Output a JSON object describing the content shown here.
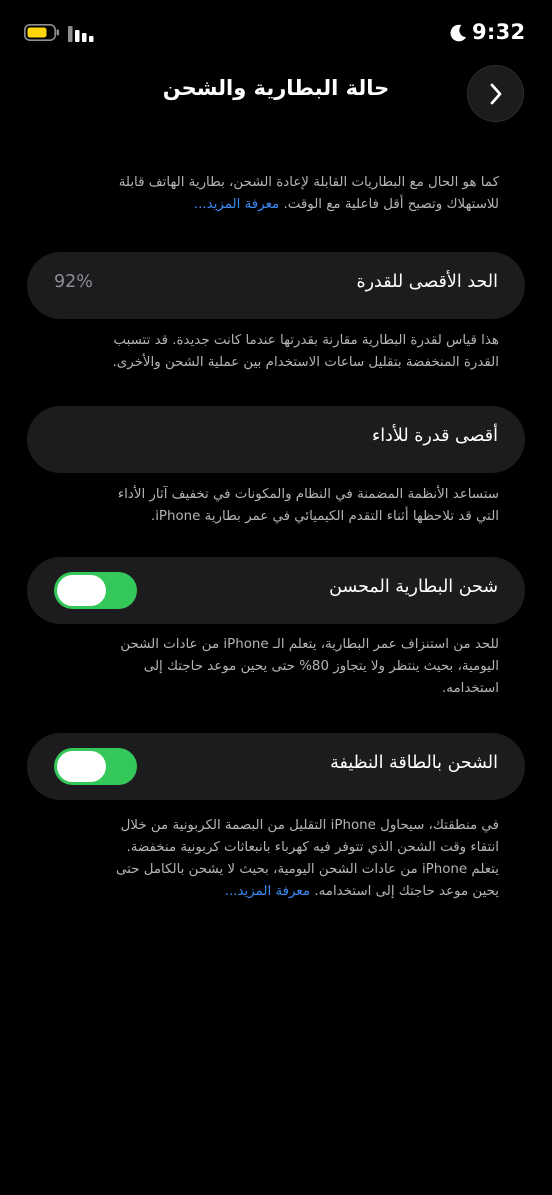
{
  "status_bar": {
    "time": "9:32",
    "battery_icon": "battery-low-power-icon",
    "signal_icon": "cellular-signal-icon",
    "focus_icon": "moon-icon",
    "battery_color": "#ffd60a"
  },
  "nav": {
    "title": "حالة البطارية والشحن",
    "back_icon": "chevron-icon"
  },
  "intro": {
    "line1": "كما هو الحال مع البطاريات القابلة لإعادة الشحن، بطارية الهاتف قابلة",
    "line2": "للاستهلاك وتصبح أقل فاعلية مع الوقت.",
    "link": "معرفة المزيد..."
  },
  "max_capacity": {
    "label": "الحد الأقصى للقدرة",
    "value": "92%",
    "footnote_line1": "هذا قياس لقدرة البطارية مقارنة بقدرتها عندما كانت جديدة. قد تتسبب",
    "footnote_line2": "القدرة المنخفضة بتقليل ساعات الاستخدام بين عملية الشحن والأخرى."
  },
  "peak_performance": {
    "label": "أقصى قدرة للأداء",
    "footnote_line1": "ستساعد الأنظمة المضمنة في النظام والمكونات في تخفيف آثار الأداء",
    "footnote_line2": "التي قد تلاحظها أثناء التقدم الكيميائي في عمر بطارية iPhone."
  },
  "optimized_charging": {
    "label": "شحن البطارية المحسن",
    "enabled": true,
    "footnote_line1": "للحد من استنزاف عمر البطارية، يتعلم الـ iPhone من عادات الشحن",
    "footnote_line2": "اليومية، بحيث ينتظر ولا يتجاوز 80% حتى يحين موعد حاجتك إلى",
    "footnote_line3": "استخدامه."
  },
  "clean_energy": {
    "label": "الشحن بالطاقة النظيفة",
    "enabled": true,
    "footnote_line1": "في منطقتك، سيحاول iPhone التقليل من البصمة الكربونية من خلال",
    "footnote_line2": "انتقاء وقت الشحن الذي تتوفر فيه كهرباء بانبعاثات كربونية منخفضة.",
    "footnote_line3": "يتعلم iPhone من عادات الشحن اليومية، بحيث لا يشحن بالكامل حتى",
    "footnote_line4": "يحين موعد حاجتك إلى استخدامه.",
    "link": "معرفة المزيد..."
  },
  "colors": {
    "background": "#000000",
    "card": "#1c1c1e",
    "toggle_on": "#34c759",
    "link": "#3b8cf5",
    "secondary_text": "#b4b4b8"
  }
}
